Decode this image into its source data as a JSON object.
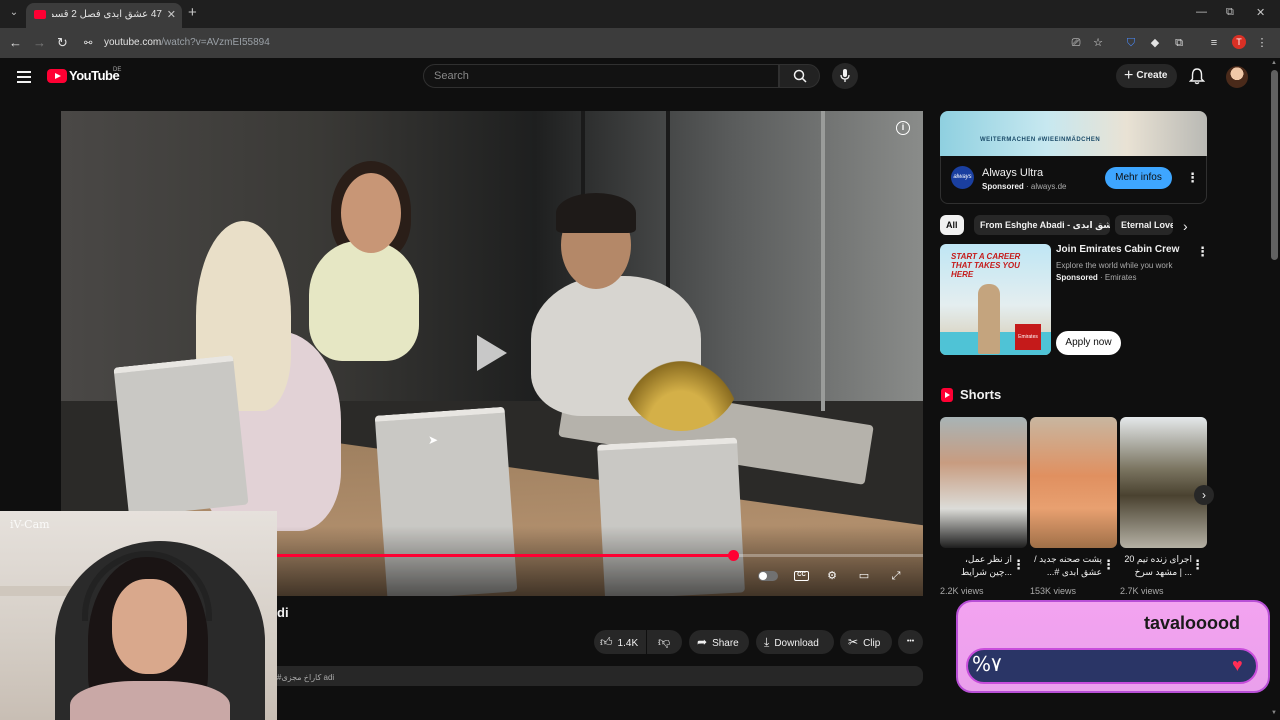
{
  "browser": {
    "tab_title": "47 عشق ابدی فصل 2 قسمت 🔊",
    "tab_close": "✕",
    "new_tab": "+",
    "url_host": "youtube.com",
    "url_path": "/watch?v=AVzmEI55894",
    "profile_initial": "T",
    "win_minimize": "—",
    "win_restore": "⧉",
    "win_close": "✕"
  },
  "youtube": {
    "wordmark": "YouTube",
    "region": "DE",
    "search_placeholder": "Search",
    "create_label": "Create"
  },
  "player": {
    "progress_fraction": 0.78,
    "controls": {
      "settings": "⚙",
      "theater": "▭",
      "fullscreen": "⤢"
    },
    "info": "i"
  },
  "below_video": {
    "title_fragment": "di",
    "likes": "1.4K",
    "share_label": "Share",
    "download_label": "Download",
    "clip_label": "Clip",
    "more": "•••",
    "description_tag": "#کاراخ مجزی adi"
  },
  "webcam": {
    "watermark": "iV-Cam"
  },
  "sidebar": {
    "ad": {
      "banner_text": "WEITERMACHEN #WIEEINMÄDCHEN",
      "logo_text": "always",
      "title": "Always Ultra",
      "sponsored": "Sponsored",
      "domain": "always.de",
      "cta": "Mehr infos"
    },
    "chips": [
      {
        "label": "All"
      },
      {
        "label": "From Eshghe Abadi - عشق ابدی"
      },
      {
        "label": "Eternal Love"
      }
    ],
    "promo": {
      "headline": "START A CAREER THAT TAKES YOU HERE",
      "logo_text": "Emirates",
      "title": "Join Emirates Cabin Crew",
      "desc": "Explore the world while you work",
      "sponsored": "Sponsored",
      "advertiser": "Emirates",
      "cta": "Apply now"
    },
    "shorts_title": "Shorts",
    "shorts": [
      {
        "caption": "از نظر عمل، ...چین شرایط ادامه",
        "views": "2.2K views"
      },
      {
        "caption": "پشت صحنه جدید / عشق ابدی #...",
        "views": "153K views"
      },
      {
        "caption": "اجرای زنده تیم 20 ... | مشهد سرخ",
        "views": "2.7K views"
      }
    ]
  },
  "alert": {
    "name": "tavalooood",
    "amount": "%۷"
  },
  "colors": {
    "yt_red": "#ff0033",
    "cta_blue": "#3ea6ff",
    "alert_pink": "#f3a3f0",
    "alert_bar": "#2a3566"
  }
}
